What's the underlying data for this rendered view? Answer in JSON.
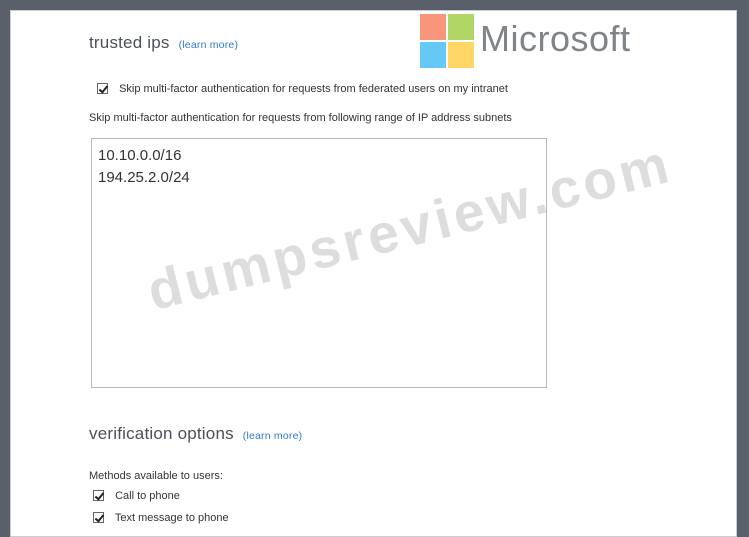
{
  "trusted_ips": {
    "title": "trusted ips",
    "learn_more": "(learn more)",
    "skip_federated_label": "Skip multi-factor authentication for requests from federated users on my intranet",
    "skip_federated_checked": true,
    "subnets_label": "Skip multi-factor authentication for requests from following range of IP address subnets",
    "subnets_value": "10.10.0.0/16\n194.25.2.0/24"
  },
  "verification": {
    "title": "verification options",
    "learn_more": "(learn more)",
    "methods_label": "Methods available to users:",
    "methods": [
      {
        "label": "Call to phone",
        "checked": true
      },
      {
        "label": "Text message to phone",
        "checked": true
      }
    ]
  },
  "logo": {
    "text": "Microsoft",
    "colors": [
      "#f25022",
      "#7fba00",
      "#00a4ef",
      "#ffb900"
    ]
  },
  "watermark": "dumpsreview.com"
}
